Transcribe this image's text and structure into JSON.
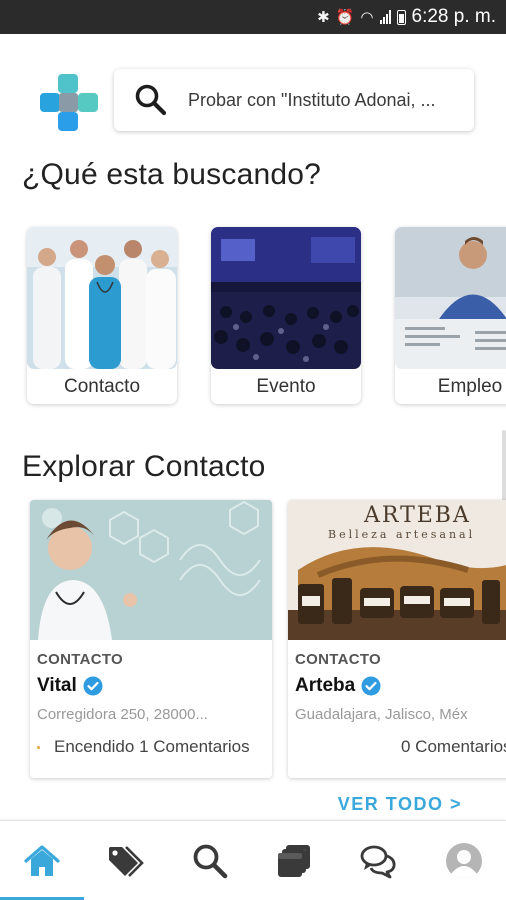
{
  "status_bar": {
    "time": "6:28 p. m.",
    "icons": [
      "bluetooth-icon",
      "alarm-icon",
      "wifi-icon",
      "signal-icon",
      "battery-icon"
    ]
  },
  "header": {
    "search": {
      "placeholder": "Probar con \"Instituto Adonai, ..."
    }
  },
  "categories_section": {
    "title": "¿Qué esta buscando?",
    "items": [
      {
        "label": "Contacto"
      },
      {
        "label": "Evento"
      },
      {
        "label": "Empleo"
      }
    ]
  },
  "explore_section": {
    "title": "Explorar Contacto",
    "cards": [
      {
        "type": "CONTACTO",
        "name": "Vital",
        "address": "Corregidora 250, 28000...",
        "meta": "Encendido 1 Comentarios"
      },
      {
        "type": "CONTACTO",
        "name": "Arteba",
        "address": "Guadalajara, Jalisco, Méx",
        "meta": "0 Comentarios",
        "image_text": {
          "brand": "ARTEBA",
          "tagline": "Belleza artesanal"
        }
      }
    ],
    "see_all": "VER TODO >"
  },
  "bottom_nav": {
    "items": [
      "home-icon",
      "tags-icon",
      "search-icon",
      "listings-icon",
      "chat-icon",
      "profile-icon"
    ],
    "active": "home-icon"
  },
  "colors": {
    "accent": "#3aa8db",
    "status_bar": "#2b2b2b",
    "verified": "#2f9be0"
  }
}
